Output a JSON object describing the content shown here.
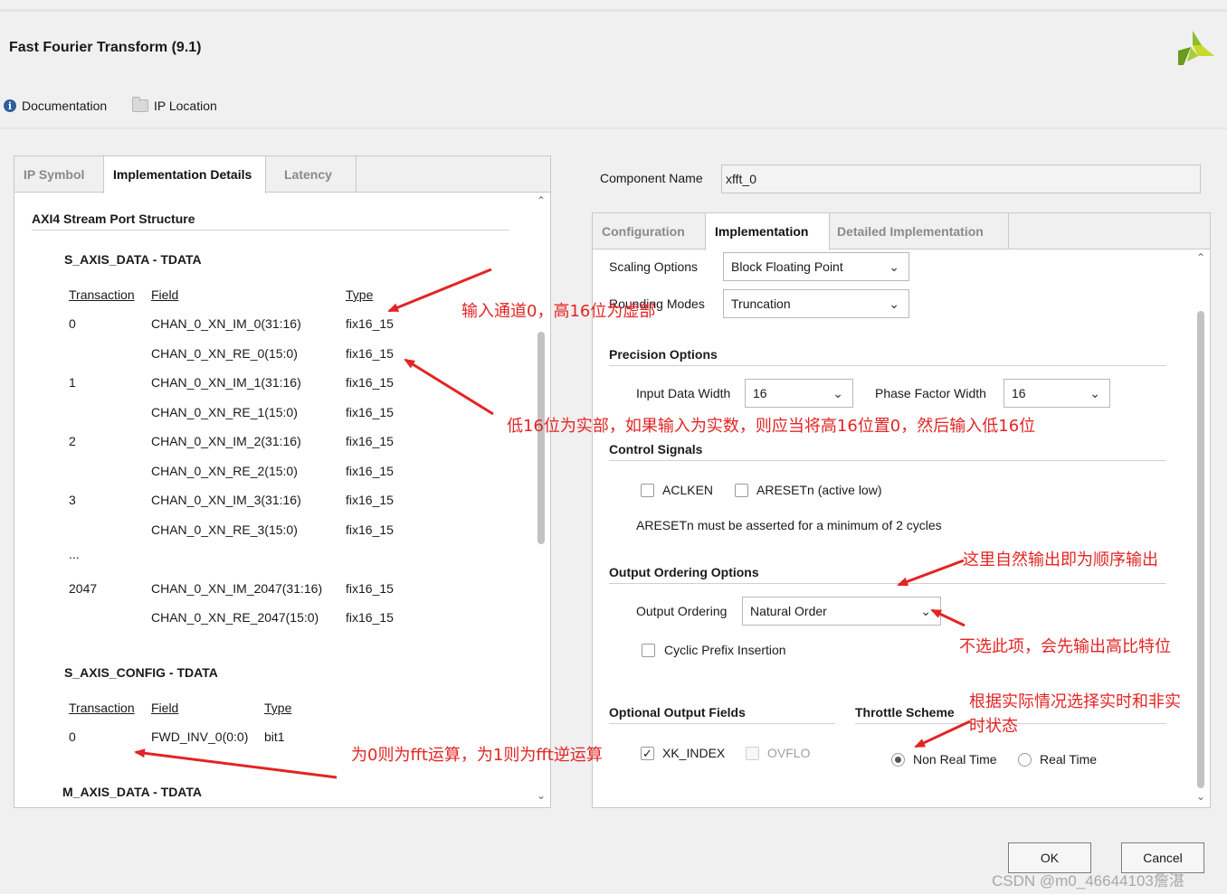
{
  "window": {
    "title": "Fast Fourier Transform (9.1)"
  },
  "toolbar": {
    "documentation": "Documentation",
    "ip_location": "IP Location"
  },
  "left": {
    "tabs": [
      "IP Symbol",
      "Implementation Details",
      "Latency"
    ],
    "heading": "AXI4 Stream Port Structure",
    "s_axis_data": {
      "title": "S_AXIS_DATA - TDATA",
      "headers": [
        "Transaction",
        "Field",
        "Type"
      ],
      "rows": [
        [
          "0",
          "CHAN_0_XN_IM_0(31:16)",
          "fix16_15"
        ],
        [
          "",
          "CHAN_0_XN_RE_0(15:0)",
          "fix16_15"
        ],
        [
          "1",
          "CHAN_0_XN_IM_1(31:16)",
          "fix16_15"
        ],
        [
          "",
          "CHAN_0_XN_RE_1(15:0)",
          "fix16_15"
        ],
        [
          "2",
          "CHAN_0_XN_IM_2(31:16)",
          "fix16_15"
        ],
        [
          "",
          "CHAN_0_XN_RE_2(15:0)",
          "fix16_15"
        ],
        [
          "3",
          "CHAN_0_XN_IM_3(31:16)",
          "fix16_15"
        ],
        [
          "",
          "CHAN_0_XN_RE_3(15:0)",
          "fix16_15"
        ],
        [
          "...",
          "",
          ""
        ],
        [
          "2047",
          "CHAN_0_XN_IM_2047(31:16)",
          "fix16_15"
        ],
        [
          "",
          "CHAN_0_XN_RE_2047(15:0)",
          "fix16_15"
        ]
      ]
    },
    "s_axis_config": {
      "title": "S_AXIS_CONFIG - TDATA",
      "headers": [
        "Transaction",
        "Field",
        "Type"
      ],
      "rows": [
        [
          "0",
          "FWD_INV_0(0:0)",
          "bit1"
        ]
      ]
    },
    "m_axis_data": {
      "title": "M_AXIS_DATA - TDATA"
    }
  },
  "right": {
    "component_name_label": "Component Name",
    "component_name_value": "xfft_0",
    "tabs": [
      "Configuration",
      "Implementation",
      "Detailed Implementation"
    ],
    "scaling_label": "Scaling Options",
    "scaling_value": "Block Floating Point",
    "rounding_label": "Rounding Modes",
    "rounding_value": "Truncation",
    "precision_title": "Precision Options",
    "input_width_label": "Input Data Width",
    "input_width_value": "16",
    "phase_width_label": "Phase Factor Width",
    "phase_width_value": "16",
    "control_title": "Control Signals",
    "aclken": "ACLKEN",
    "aresetn": "ARESETn (active low)",
    "aresetn_note": "ARESETn must be asserted for a minimum of 2 cycles",
    "output_ordering_title": "Output Ordering Options",
    "output_ordering_label": "Output Ordering",
    "output_ordering_value": "Natural Order",
    "cyclic_prefix": "Cyclic Prefix Insertion",
    "optional_title": "Optional Output Fields",
    "xk_index": "XK_INDEX",
    "ovflo": "OVFLO",
    "throttle_title": "Throttle Scheme",
    "non_real_time": "Non Real Time",
    "real_time": "Real Time"
  },
  "buttons": {
    "ok": "OK",
    "cancel": "Cancel"
  },
  "annotations": {
    "a1": "输入通道0，高16位为虚部",
    "a2": "低16位为实部，如果输入为实数，则应当将高16位置0，然后输入低16位",
    "a3": "这里自然输出即为顺序输出",
    "a4": "不选此项，会先输出高比特位",
    "a5_line1": "根据实际情况选择实时和非实",
    "a5_line2": "时状态",
    "a6": "为0则为fft运算，为1则为fft逆运算"
  },
  "watermark": "CSDN @m0_46644103詹湛",
  "colors": {
    "annotation": "#e32424",
    "logo_green": "#8cbf26",
    "logo_yellow": "#c7d92a"
  }
}
